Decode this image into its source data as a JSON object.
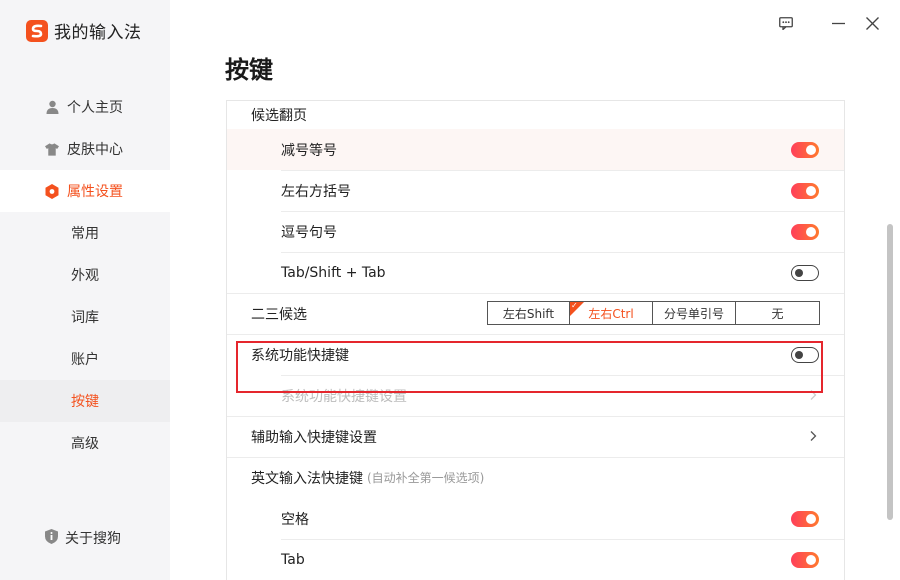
{
  "app": {
    "name": "我的输入法",
    "brand_color": "#f4511e"
  },
  "sidebar": {
    "items": [
      {
        "label": "个人主页",
        "icon": "user-icon"
      },
      {
        "label": "皮肤中心",
        "icon": "tshirt-icon"
      },
      {
        "label": "属性设置",
        "icon": "settings-hex-icon",
        "active": true
      }
    ],
    "sub_items": [
      {
        "label": "常用"
      },
      {
        "label": "外观"
      },
      {
        "label": "词库"
      },
      {
        "label": "账户"
      },
      {
        "label": "按键",
        "active": true
      },
      {
        "label": "高级"
      }
    ],
    "about": {
      "label": "关于搜狗",
      "icon": "info-shield-icon"
    }
  },
  "window_controls": [
    "feedback-icon",
    "minimize-icon",
    "close-icon"
  ],
  "main": {
    "title": "按键",
    "candidate_paging": {
      "label": "候选翻页",
      "options": [
        {
          "label": "减号等号",
          "enabled": true
        },
        {
          "label": "左右方括号",
          "enabled": true
        },
        {
          "label": "逗号句号",
          "enabled": true
        },
        {
          "label": "Tab/Shift + Tab",
          "enabled": false
        }
      ]
    },
    "second_third_candidate": {
      "label": "二三候选",
      "options": [
        "左右Shift",
        "左右Ctrl",
        "分号单引号",
        "无"
      ],
      "selected": "左右Ctrl"
    },
    "system_shortcuts": {
      "label": "系统功能快捷键",
      "enabled": false,
      "settings_label": "系统功能快捷键设置"
    },
    "aux_input_shortcuts": {
      "label": "辅助输入快捷键设置"
    },
    "english_shortcuts": {
      "label": "英文输入法快捷键",
      "hint": "(自动补全第一候选项)",
      "options": [
        {
          "label": "空格",
          "enabled": true
        },
        {
          "label": "Tab",
          "enabled": true
        }
      ]
    }
  },
  "colors": {
    "accent": "#f4511e",
    "toggle_on_start": "#ff3f5a",
    "toggle_on_end": "#ff7a2e",
    "highlight_box": "#e5262d"
  }
}
